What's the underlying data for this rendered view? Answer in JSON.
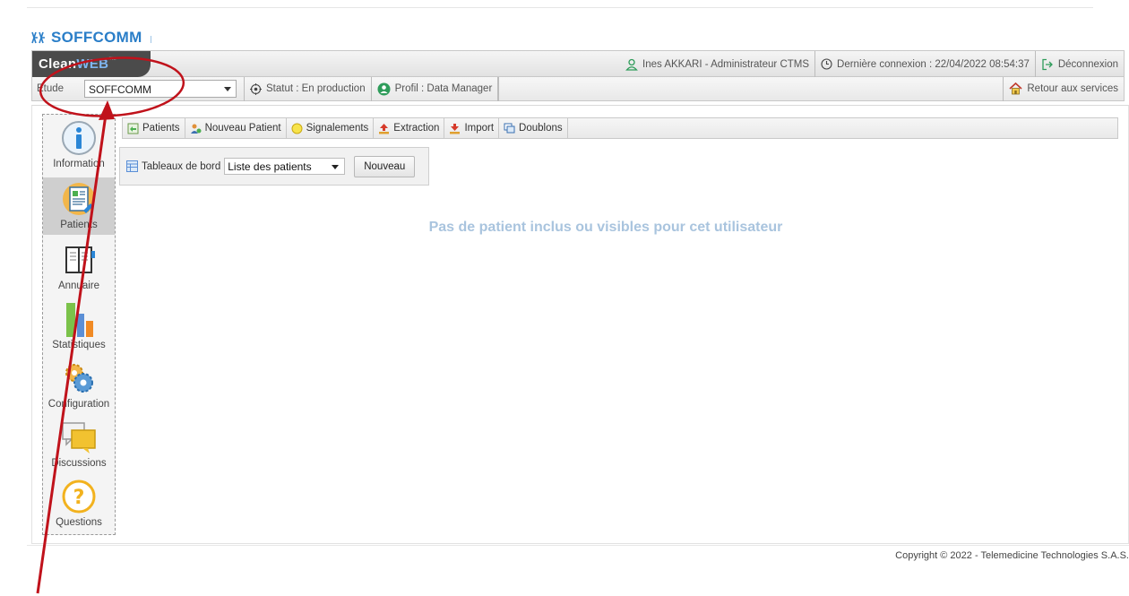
{
  "brand": {
    "name": "SOFFCOMM"
  },
  "app": {
    "name_part1": "Clean",
    "name_part2": "WEB",
    "trademark": "™"
  },
  "header": {
    "user": "Ines AKKARI - Administrateur CTMS",
    "last_login": "Dernière connexion : 22/04/2022 08:54:37",
    "logout": "Déconnexion"
  },
  "study_bar": {
    "label": "Etude",
    "selected_study": "SOFFCOMM",
    "status": "Statut : En production",
    "profile": "Profil : Data Manager",
    "back": "Retour aux services"
  },
  "sidebar": {
    "items": [
      {
        "label": "Information",
        "icon": "info-icon"
      },
      {
        "label": "Patients",
        "icon": "patients-icon"
      },
      {
        "label": "Annuaire",
        "icon": "directory-icon"
      },
      {
        "label": "Statistiques",
        "icon": "statistics-icon"
      },
      {
        "label": "Configuration",
        "icon": "configuration-icon"
      },
      {
        "label": "Discussions",
        "icon": "discussions-icon"
      },
      {
        "label": "Questions",
        "icon": "questions-icon"
      }
    ]
  },
  "tabs": [
    {
      "label": "Patients",
      "icon": "patients-tab-icon"
    },
    {
      "label": "Nouveau Patient",
      "icon": "new-patient-icon"
    },
    {
      "label": "Signalements",
      "icon": "alert-icon"
    },
    {
      "label": "Extraction",
      "icon": "extraction-icon"
    },
    {
      "label": "Import",
      "icon": "import-icon"
    },
    {
      "label": "Doublons",
      "icon": "duplicates-icon"
    }
  ],
  "dashboard": {
    "label": "Tableaux de bord",
    "selected": "Liste des patients",
    "new_button": "Nouveau"
  },
  "main": {
    "empty_message": "Pas de patient inclus ou visibles pour cet utilisateur"
  },
  "footer": {
    "copyright": "Copyright © 2022 - Telemedicine Technologies S.A.S."
  },
  "colors": {
    "brand_blue": "#2a7ec8",
    "annotation_red": "#c0121b",
    "empty_text": "#a9c4de"
  }
}
